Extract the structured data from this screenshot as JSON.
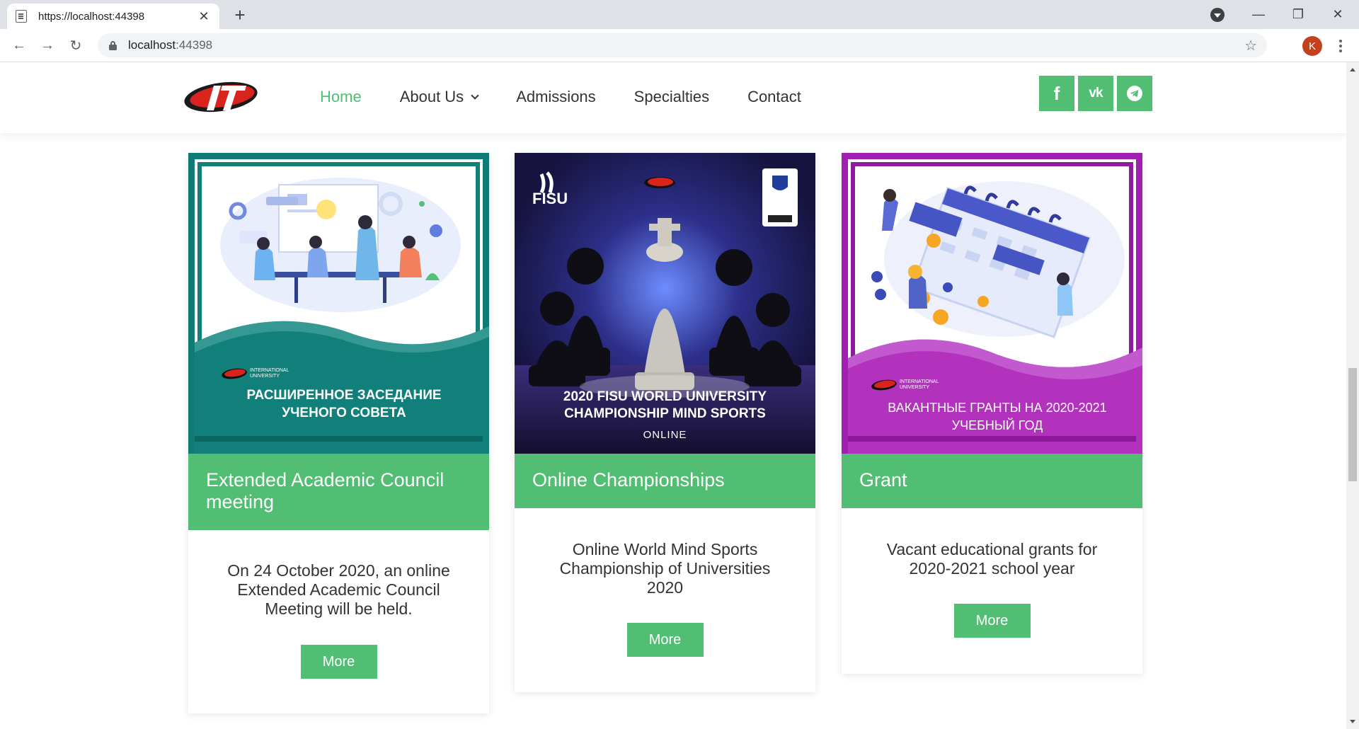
{
  "browser": {
    "tab_title": "https://localhost:44398",
    "url_host": "localhost",
    "url_port": ":44398",
    "avatar_letter": "K"
  },
  "nav": {
    "home": "Home",
    "about": "About Us",
    "admissions": "Admissions",
    "specialties": "Specialties",
    "contact": "Contact"
  },
  "social": {
    "facebook": "f",
    "vk": "vk"
  },
  "cards": [
    {
      "image_text": "РАСШИРЕННОЕ ЗАСЕДАНИЕ УЧЕНОГО СОВЕТА",
      "title": "Extended Academic Council meeting",
      "text": "On 24 October 2020, an online Extended Academic Council Meeting will be held.",
      "button": "More"
    },
    {
      "image_text": "2020 FISU WORLD UNIVERSITY CHAMPIONSHIP MIND SPORTS",
      "image_subtext": "ONLINE",
      "image_brand": "FISU",
      "title": "Online Championships",
      "text": "Online World Mind Sports Championship of Universities 2020",
      "button": "More"
    },
    {
      "image_text": "ВАКАНТНЫЕ ГРАНТЫ НА 2020-2021 УЧЕБНЫЙ ГОД",
      "title": "Grant",
      "text": "Vacant educational grants for 2020-2021 school year",
      "button": "More"
    }
  ],
  "image_badge": {
    "line1": "INTERNATIONAL",
    "line2": "UNIVERSITY"
  },
  "colors": {
    "accent": "#52be74",
    "teal": "#0e7c78",
    "purple": "#9b1fa8",
    "navy": "#1c1a4a"
  }
}
